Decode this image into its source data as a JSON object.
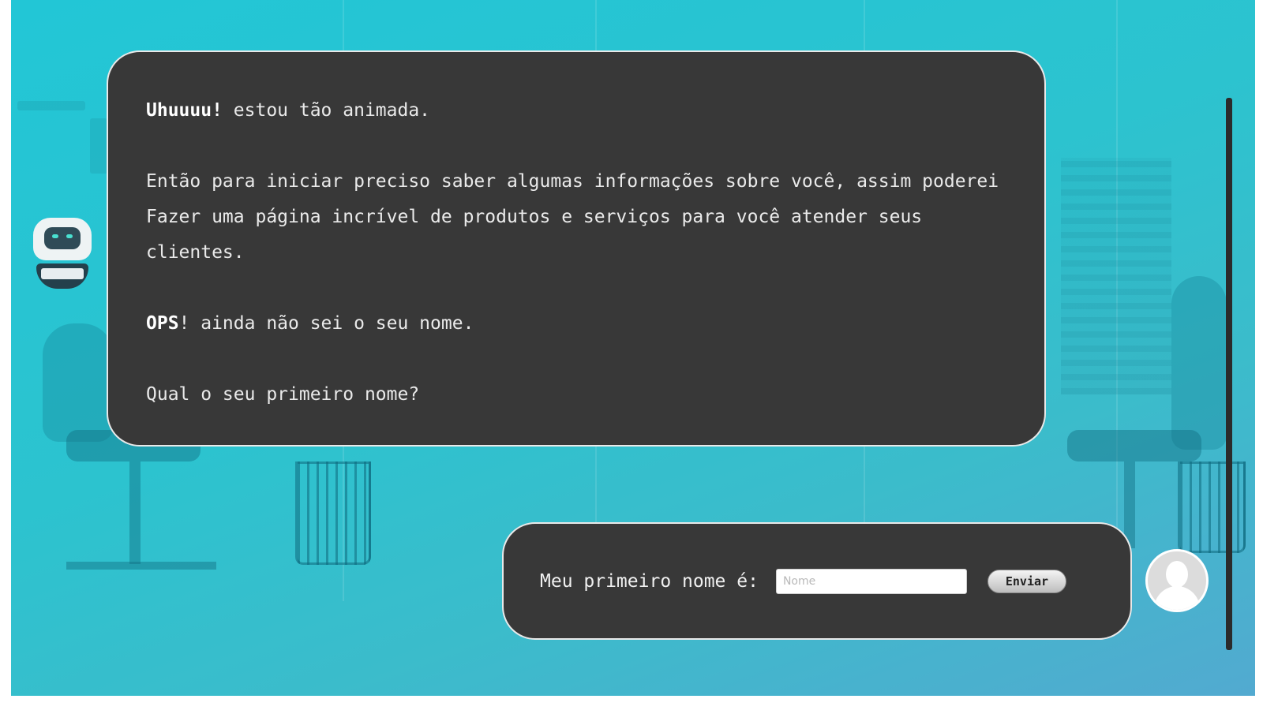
{
  "bot": {
    "avatar_icon": "robot-icon",
    "messages": [
      {
        "strong": "Uhuuuu!",
        "text": " estou tão animada."
      },
      {
        "strong": "",
        "text": "Então para iniciar preciso saber algumas informações sobre você, assim poderei Fazer uma página incrível de produtos e serviços para você atender seus clientes."
      },
      {
        "strong": "OPS",
        "text": "! ainda não sei o seu nome."
      },
      {
        "strong": "",
        "text": "Qual o seu primeiro nome?"
      }
    ]
  },
  "user_form": {
    "label": "Meu primeiro nome é:",
    "input_placeholder": "Nome",
    "input_value": "",
    "submit_label": "Enviar",
    "avatar_icon": "user-avatar-icon"
  },
  "colors": {
    "background_start": "#22c6d6",
    "background_end": "#52aad0",
    "bubble": "#383838",
    "bubble_border": "#e9e9e9"
  }
}
